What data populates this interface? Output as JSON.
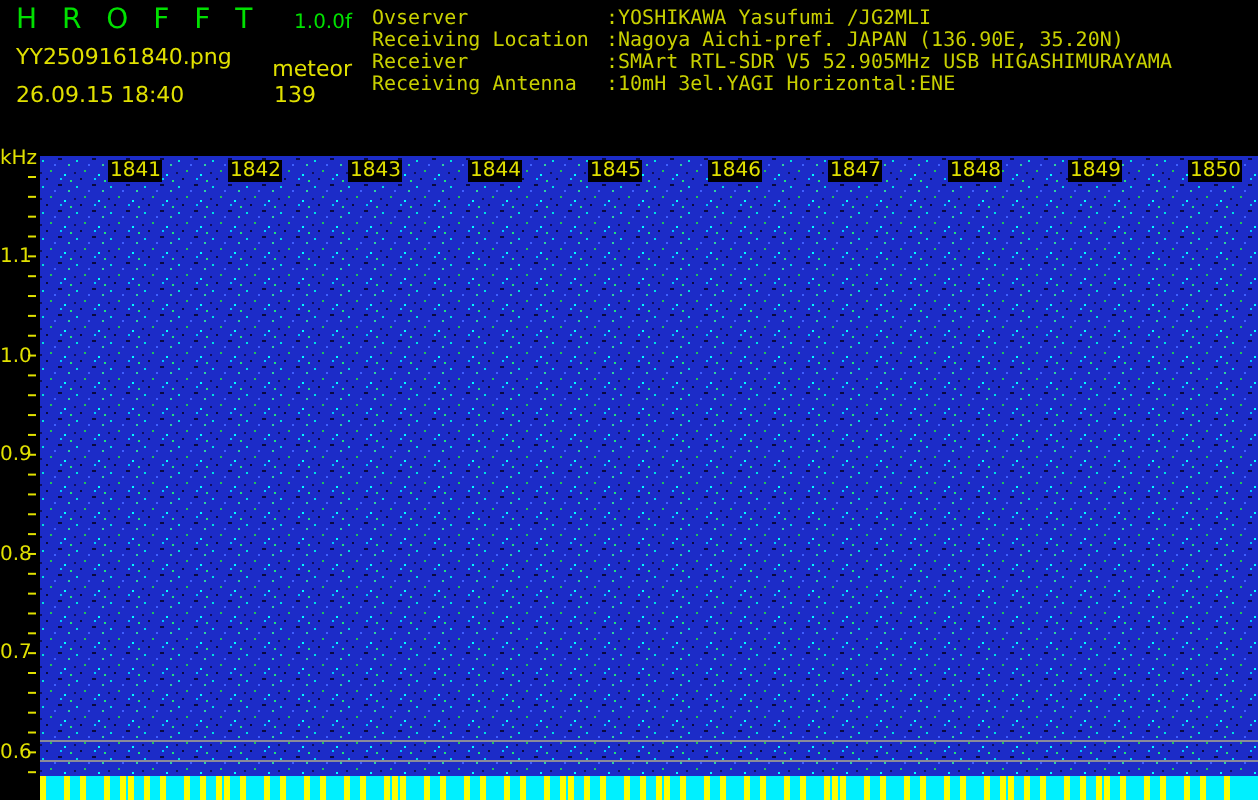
{
  "app": {
    "title": "H R O F F T",
    "version": "1.0.0f",
    "file": "YY2509161840.png",
    "date_time": "26.09.15 18:40",
    "mode": "meteor",
    "count": "139"
  },
  "info": [
    {
      "label": "Ovserver",
      "value": ":YOSHIKAWA Yasufumi /JG2MLI"
    },
    {
      "label": "Receiving Location",
      "value": ":Nagoya Aichi-pref. JAPAN (136.90E, 35.20N)"
    },
    {
      "label": "Receiver",
      "value": ":SMArt RTL-SDR V5 52.905MHz USB HIGASHIMURAYAMA"
    },
    {
      "label": "Receiving Antenna",
      "value": ":10mH 3el.YAGI Horizontal:ENE"
    }
  ],
  "spectrogram": {
    "y_unit": "kHz",
    "y_labels": [
      "1.1",
      "1.0",
      "0.9",
      "0.8",
      "0.7",
      "0.6"
    ],
    "time_labels": [
      "1841",
      "1842",
      "1843",
      "1844",
      "1845",
      "1846",
      "1847",
      "1848",
      "1849",
      "1850"
    ]
  }
}
